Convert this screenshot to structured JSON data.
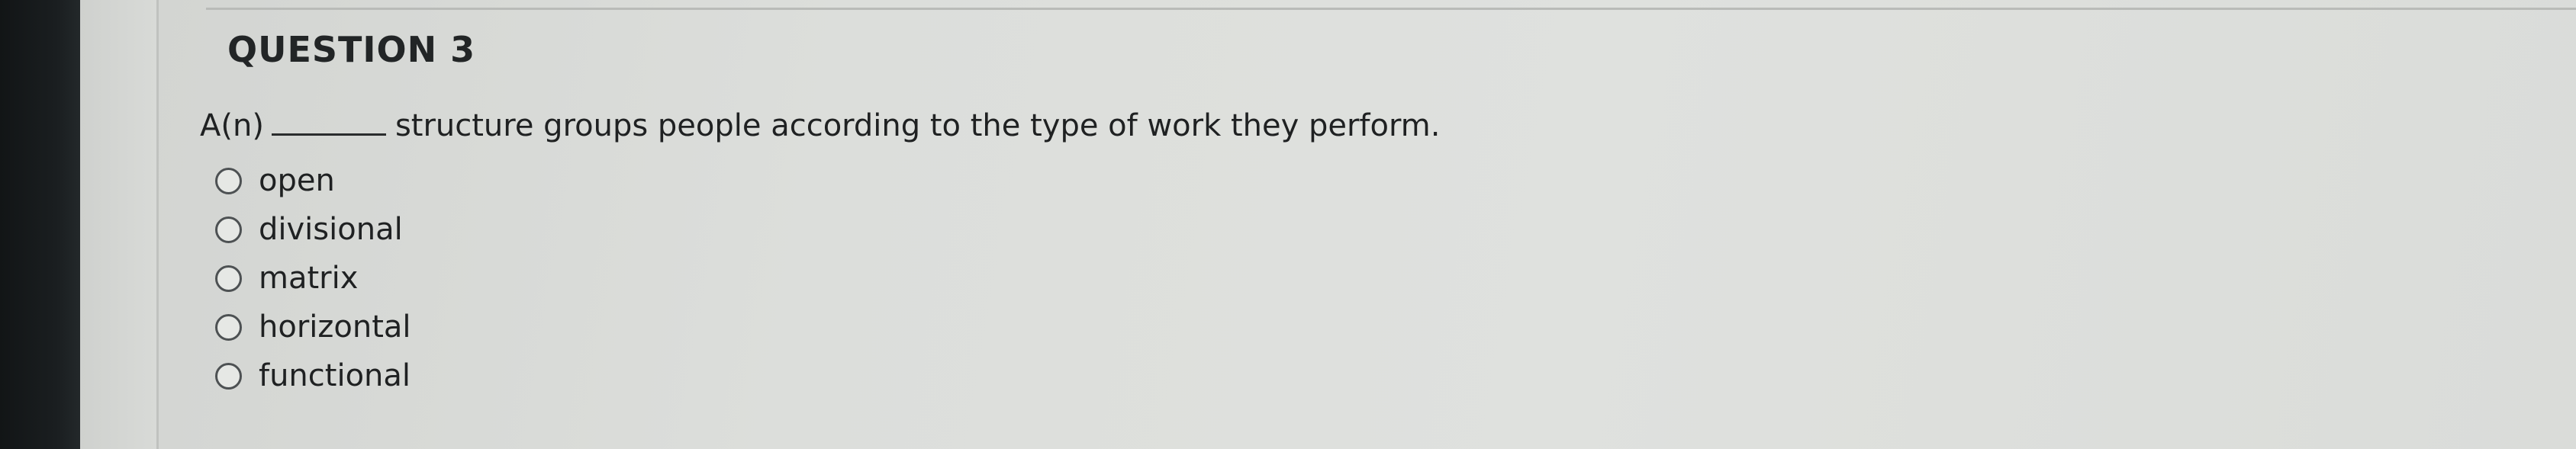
{
  "question": {
    "title": "QUESTION 3",
    "prompt_prefix": "A(n)",
    "prompt_suffix": "structure groups people according to the type of work they perform."
  },
  "options": [
    {
      "label": "open"
    },
    {
      "label": "divisional"
    },
    {
      "label": "matrix"
    },
    {
      "label": "horizontal"
    },
    {
      "label": "functional"
    }
  ]
}
